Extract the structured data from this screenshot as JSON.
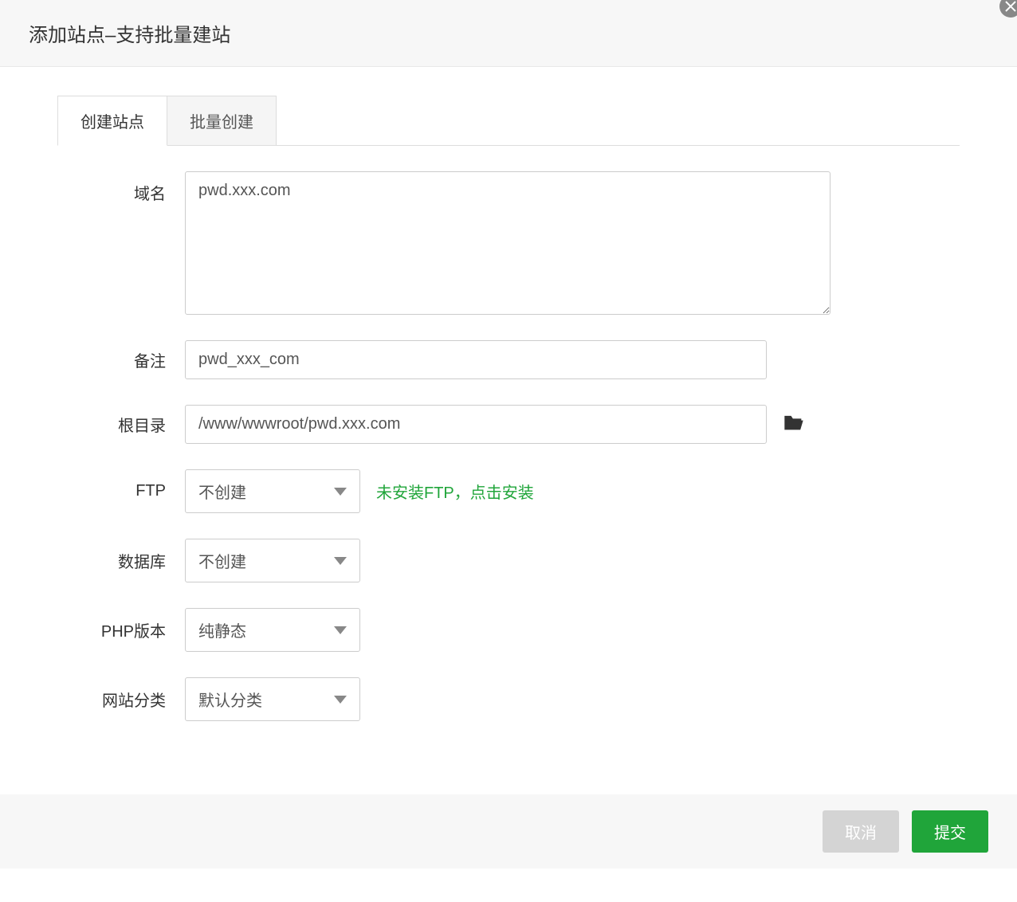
{
  "dialog": {
    "title": "添加站点–支持批量建站"
  },
  "tabs": {
    "create": "创建站点",
    "batch": "批量创建"
  },
  "form": {
    "domain": {
      "label": "域名",
      "value": "pwd.xxx.com"
    },
    "remark": {
      "label": "备注",
      "value": "pwd_xxx_com"
    },
    "root": {
      "label": "根目录",
      "value": "/www/wwwroot/pwd.xxx.com"
    },
    "ftp": {
      "label": "FTP",
      "value": "不创建",
      "hint": "未安装FTP，点击安装"
    },
    "database": {
      "label": "数据库",
      "value": "不创建"
    },
    "php": {
      "label": "PHP版本",
      "value": "纯静态"
    },
    "category": {
      "label": "网站分类",
      "value": "默认分类"
    }
  },
  "footer": {
    "cancel": "取消",
    "submit": "提交"
  }
}
